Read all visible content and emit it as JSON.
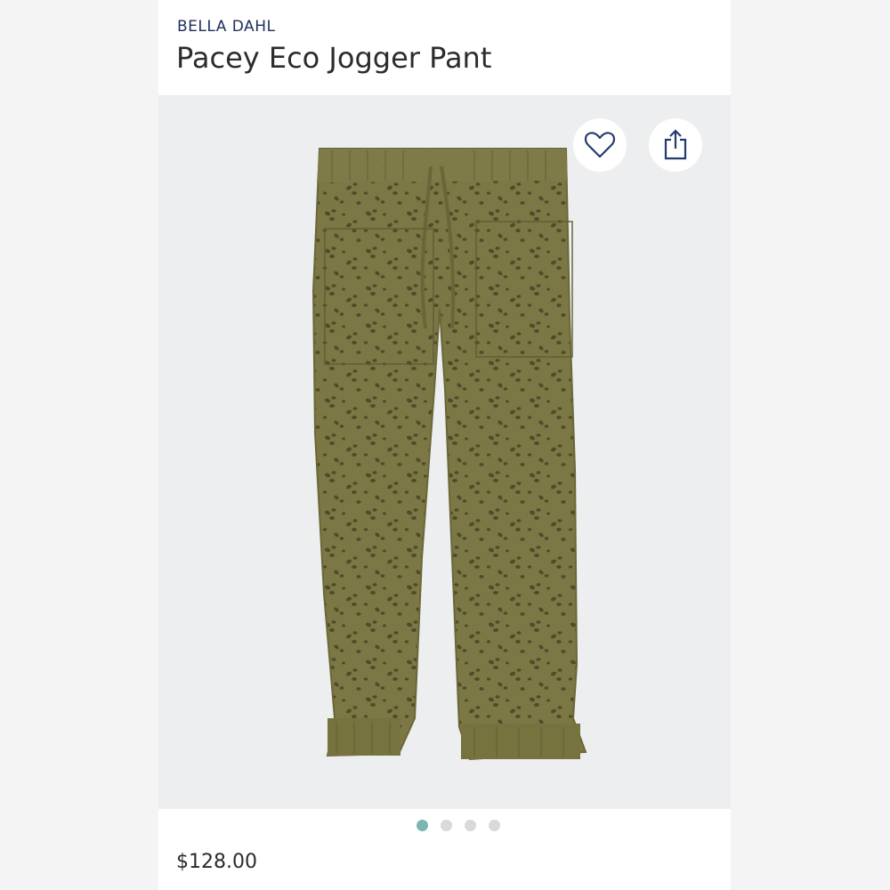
{
  "product": {
    "brand": "BELLA DAHL",
    "title": "Pacey Eco Jogger Pant",
    "price": "$128.00"
  },
  "image": {
    "description_icon": "olive-leopard-jogger-pants",
    "background_color": "#eceeef",
    "fabric_color": "#7a7743",
    "print_color": "#4e4a2a"
  },
  "actions": {
    "favorite_icon": "heart-icon",
    "share_icon": "share-icon"
  },
  "carousel": {
    "count": 4,
    "active_index": 0,
    "active_color": "#7cb7ae"
  }
}
